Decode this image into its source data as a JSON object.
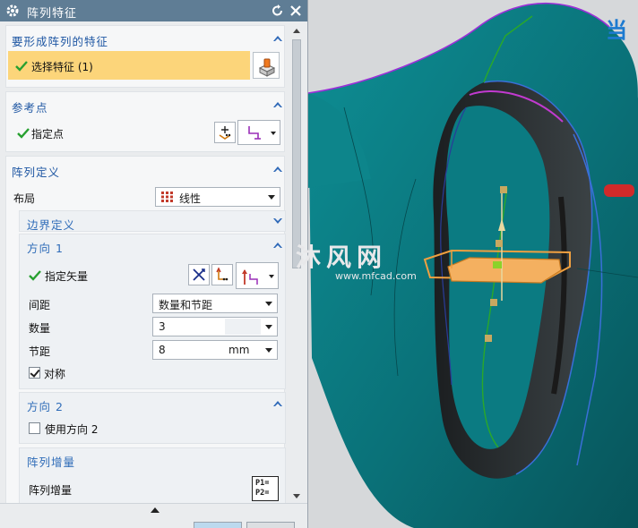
{
  "dialog": {
    "title": "阵列特征",
    "icons": {
      "title": "gear-icon",
      "reset": "reset-icon",
      "close": "close-icon"
    }
  },
  "feature_group": {
    "heading": "要形成阵列的特征",
    "select_label": "选择特征 (1)"
  },
  "reference_group": {
    "heading": "参考点",
    "specify_point_label": "指定点"
  },
  "pattern_group": {
    "heading": "阵列定义",
    "layout_label": "布局",
    "layout_value": "线性",
    "boundary": {
      "heading": "边界定义"
    },
    "direction1": {
      "heading": "方向 1",
      "vector_label": "指定矢量",
      "spacing_label": "间距",
      "spacing_value": "数量和节距",
      "count_label": "数量",
      "count_value": "3",
      "pitch_label": "节距",
      "pitch_value": "8",
      "pitch_unit": "mm",
      "symmetric_label": "对称",
      "symmetric_checked": true
    },
    "direction2": {
      "heading": "方向 2",
      "use_label": "使用方向 2",
      "use_checked": false
    },
    "increment": {
      "heading": "阵列增量",
      "label": "阵列增量",
      "icon_text_1": "P1=",
      "icon_text_2": "P2="
    }
  },
  "viewport": {
    "watermark_big": "沐风网",
    "watermark_url": "www.mfcad.com",
    "corner_text": "当"
  },
  "colors": {
    "title_bar": "#5f7d95",
    "section_heading": "#1f57a3",
    "selected_row": "#fcd57a",
    "model_teal": "#0a7f86"
  }
}
